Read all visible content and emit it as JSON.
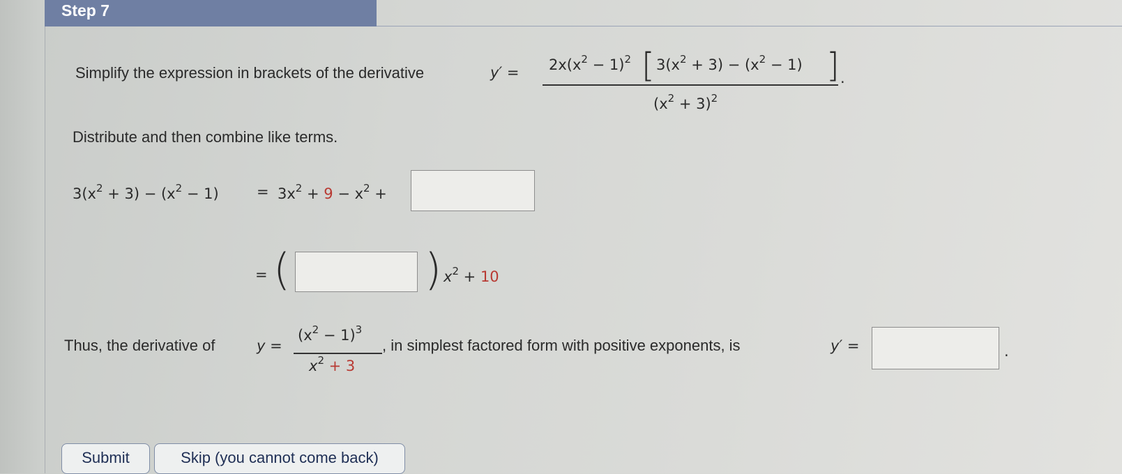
{
  "step": {
    "title": "Step 7"
  },
  "instruction1": {
    "text": "Simplify the expression in brackets of the derivative",
    "lhs": "y′ =",
    "numerator": {
      "part1": "2x(x",
      "part2": " − 1)",
      "inner": "3(x",
      "inner2": " + 3) − (x",
      "inner3": " − 1)"
    },
    "denominator": {
      "part1": "(x",
      "part2": " + 3)"
    },
    "period": ".",
    "exp2": "2"
  },
  "instruction2": {
    "text": "Distribute and then combine like terms."
  },
  "line1": {
    "lhs_a": "3(x",
    "lhs_b": " + 3) − (x",
    "lhs_c": " − 1)",
    "eq": "=",
    "rhs_a": "3x",
    "rhs_b": " + 9 − x",
    "rhs_c": " +",
    "nine": "9",
    "answer_value": ""
  },
  "line2": {
    "eq": "=",
    "answer_value": "",
    "tail_a": "x",
    "tail_b": " + 10",
    "ten": "10"
  },
  "conclusion": {
    "text_a": "Thus, the derivative of",
    "y_eq": "y =",
    "num_a": "(x",
    "num_b": " − 1)",
    "num_exp": "3",
    "den_a": "x",
    "den_b": " + 3",
    "text_b": ", in simplest factored form with positive exponents, is",
    "yprime_eq": "y′ =",
    "period": ".",
    "answer_value": ""
  },
  "buttons": {
    "submit": "Submit",
    "skip": "Skip (you cannot come back)"
  },
  "colors": {
    "header": "#6f7fa3",
    "highlight": "#b83a33",
    "button_text": "#1f2f55"
  }
}
